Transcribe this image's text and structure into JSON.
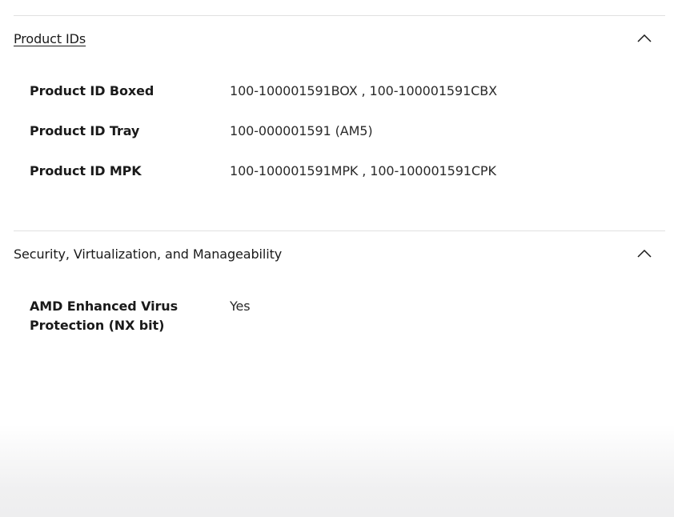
{
  "sections": [
    {
      "title": "Product IDs",
      "rows": [
        {
          "label": "Product ID Boxed",
          "value": "100-100001591BOX , 100-100001591CBX"
        },
        {
          "label": "Product ID Tray",
          "value": "100-000001591 (AM5)"
        },
        {
          "label": "Product ID MPK",
          "value": "100-100001591MPK , 100-100001591CPK"
        }
      ]
    },
    {
      "title": "Security, Virtualization, and Manageability",
      "rows": [
        {
          "label": "AMD Enhanced Virus Protection (NX bit)",
          "value": "Yes"
        }
      ]
    }
  ]
}
